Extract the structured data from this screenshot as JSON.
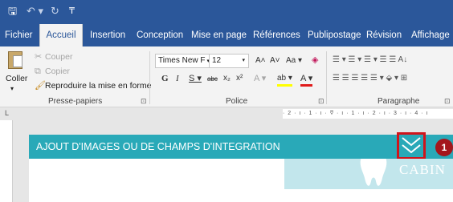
{
  "app": {
    "quick_access": {
      "save": "🖫",
      "undo": "↶ ▾",
      "redo": "↻",
      "customize": "₸"
    }
  },
  "tabs": [
    {
      "label": "Fichier",
      "active": false
    },
    {
      "label": "Accueil",
      "active": true
    },
    {
      "label": "Insertion",
      "active": false
    },
    {
      "label": "Conception",
      "active": false
    },
    {
      "label": "Mise en page",
      "active": false
    },
    {
      "label": "Références",
      "active": false
    },
    {
      "label": "Publipostage",
      "active": false
    },
    {
      "label": "Révision",
      "active": false
    },
    {
      "label": "Affichage",
      "active": false
    }
  ],
  "clipboard": {
    "paste": "Coller",
    "paste_arrow": "▾",
    "cut": "Couper",
    "copy": "Copier",
    "format_painter": "Reproduire la mise en forme",
    "group_label": "Presse-papiers",
    "launcher": "⊡"
  },
  "font": {
    "name": "Times New F",
    "size": "12",
    "grow": "A˄",
    "shrink": "A˅",
    "case": "Aa ▾",
    "clear": "◈",
    "bold": "G",
    "italic": "I",
    "underline": "S ▾",
    "strikethrough": "abc",
    "subscript": "x₂",
    "superscript": "x²",
    "text_effects": "A ▾",
    "highlight": "ab ▾",
    "font_color": "A ▾",
    "group_label": "Police",
    "launcher": "⊡"
  },
  "paragraph": {
    "row1": "☰ ▾  ☰ ▾  ☰ ▾   ☰  ☰   A↓",
    "row2": "☰  ☰  ☰  ☰   ☰ ▾   ⬙ ▾  ⊞",
    "group_label": "Paragraphe",
    "launcher": "⊡"
  },
  "ruler": {
    "marks": "· 2 · ı · 1 · ı · ⩢ · ı · 1 · ı · 2 · ı · 3 · ı · 4 · ı"
  },
  "document": {
    "banner_title": "AJOUT D'IMAGES OU DE CHAMPS D'INTEGRATION",
    "step_number": "1",
    "preview_text": "CABIN"
  },
  "colors": {
    "ribbon_blue": "#2b579a",
    "banner_teal": "#29a9b8",
    "highlight_red": "#d0141b",
    "badge_red": "#a4161c",
    "preview_teal": "#c2e6ec"
  }
}
